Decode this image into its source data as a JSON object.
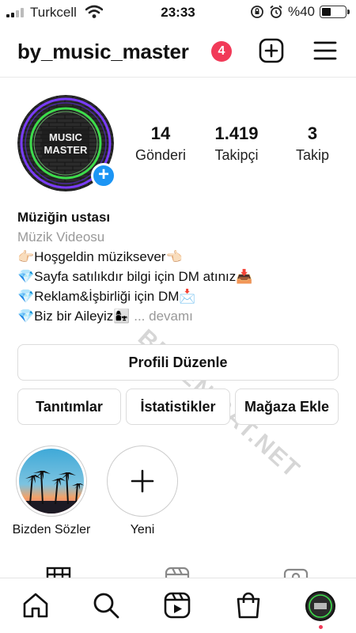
{
  "status_bar": {
    "carrier": "Turkcell",
    "time": "23:33",
    "battery": "%40",
    "battery_level": 0.4
  },
  "header": {
    "username": "by_music_master",
    "notification_count": "4"
  },
  "profile": {
    "avatar_text": [
      "MUSIC",
      "MASTER"
    ],
    "stats": [
      {
        "value": "14",
        "label": "Gönderi"
      },
      {
        "value": "1.419",
        "label": "Takipçi"
      },
      {
        "value": "3",
        "label": "Takip"
      }
    ],
    "display_name": "Müziğin ustası",
    "category": "Müzik Videosu",
    "bio_lines": [
      "👉🏻Hoşgeldin müziksever👈🏻",
      "💎Sayfa satılıkdır bilgi için DM atınız📥",
      "💎Reklam&İşbirliği için DM📩",
      "💎Biz bir Aileyiz👩‍👧"
    ],
    "more_label": "... devamı"
  },
  "watermark": "BEGENISAT.NET",
  "buttons": {
    "edit_profile": "Profili Düzenle",
    "promotions": "Tanıtımlar",
    "insights": "İstatistikler",
    "add_shop": "Mağaza Ekle"
  },
  "highlights": [
    {
      "label": "Bizden Sözler"
    },
    {
      "label": "Yeni"
    }
  ],
  "colors": {
    "accent_blue": "#1c95f4",
    "badge_red": "#f13a58",
    "neon_green": "#3ddc4b",
    "neon_purple": "#7a3cff"
  }
}
